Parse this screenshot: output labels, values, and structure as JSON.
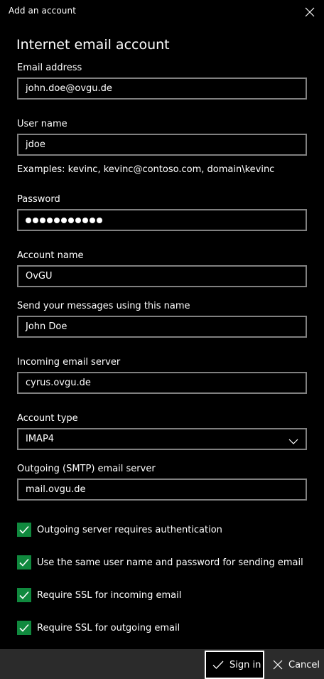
{
  "window": {
    "title": "Add an account",
    "close_icon": "close-icon"
  },
  "heading": "Internet email account",
  "fields": {
    "email": {
      "label": "Email address",
      "value": "john.doe@ovgu.de"
    },
    "username": {
      "label": "User name",
      "value": "jdoe",
      "hint": "Examples: kevinc, kevinc@contoso.com, domain\\kevinc"
    },
    "password": {
      "label": "Password",
      "masked_length": 11
    },
    "account_name": {
      "label": "Account name",
      "value": "OvGU"
    },
    "display_name": {
      "label": "Send your messages using this name",
      "value": "John Doe"
    },
    "incoming_server": {
      "label": "Incoming email server",
      "value": "cyrus.ovgu.de"
    },
    "account_type": {
      "label": "Account type",
      "value": "IMAP4"
    },
    "outgoing_server": {
      "label": "Outgoing (SMTP) email server",
      "value": "mail.ovgu.de"
    }
  },
  "checkboxes": [
    {
      "label": "Outgoing server requires authentication",
      "checked": true
    },
    {
      "label": "Use the same user name and password for sending email",
      "checked": true
    },
    {
      "label": "Require SSL for incoming email",
      "checked": true
    },
    {
      "label": "Require SSL for outgoing email",
      "checked": true
    }
  ],
  "footer": {
    "sign_in_label": "Sign in",
    "cancel_label": "Cancel"
  },
  "colors": {
    "background": "#000000",
    "footer": "#2b2b2b",
    "checkbox_accent": "#10893e",
    "input_border": "#808080"
  }
}
